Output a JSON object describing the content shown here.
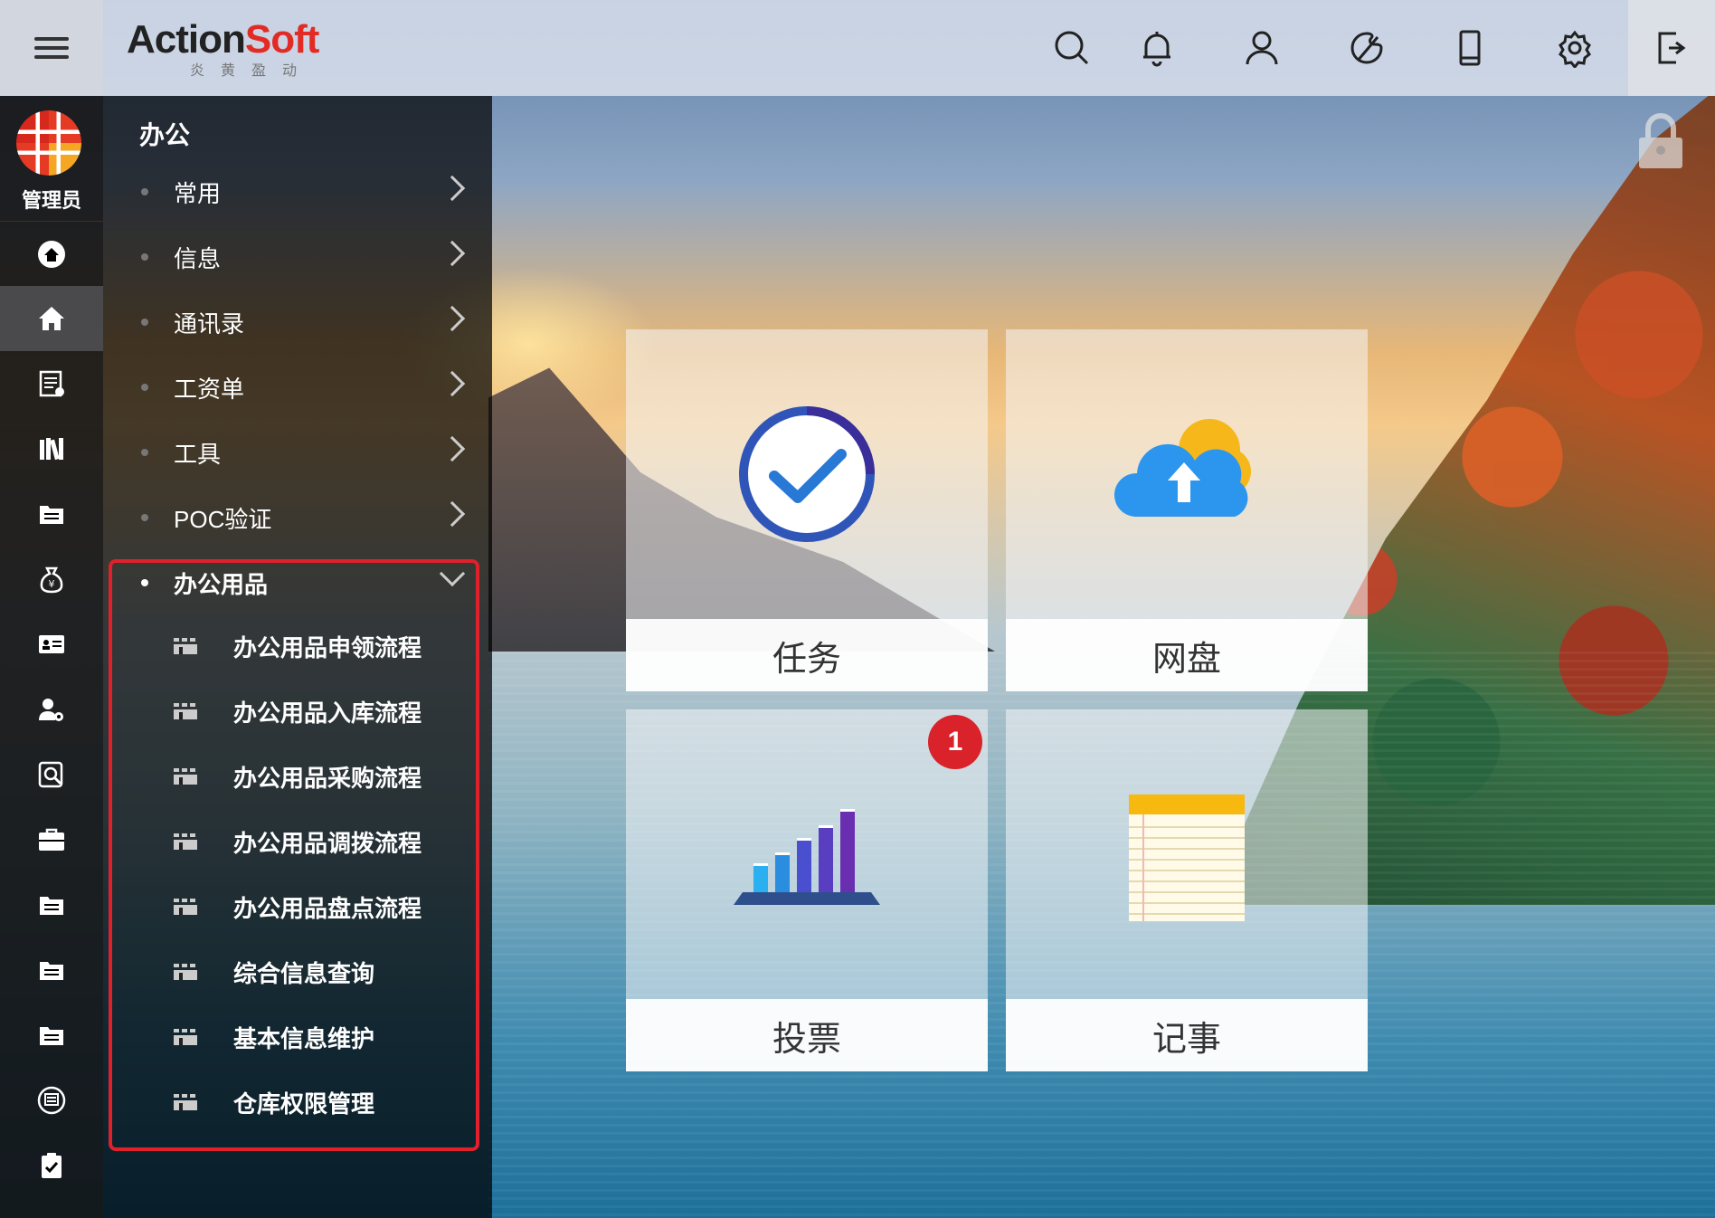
{
  "app": {
    "logo_main": "Action",
    "logo_accent": "Soft",
    "logo_sub": "炎黄盈动"
  },
  "topbar": {
    "icons": [
      "search-icon",
      "bell-icon",
      "user-icon",
      "theme-icon",
      "mobile-icon",
      "settings-icon",
      "logout-icon"
    ]
  },
  "user": {
    "name": "管理员"
  },
  "rail": {
    "icons": [
      "home-circle-icon",
      "home-icon",
      "list-doc-icon",
      "books-icon",
      "folder-icon",
      "moneybag-icon",
      "id-card-icon",
      "user-gear-icon",
      "search-doc-icon",
      "briefcase-icon",
      "folder-icon",
      "folder-icon",
      "folder-icon",
      "inbox-icon",
      "clipboard-check-icon"
    ]
  },
  "menu": {
    "title": "办公",
    "items": [
      {
        "label": "常用"
      },
      {
        "label": "信息"
      },
      {
        "label": "通讯录"
      },
      {
        "label": "工资单"
      },
      {
        "label": "工具"
      },
      {
        "label": "POC验证"
      }
    ],
    "expanded": {
      "label": "办公用品",
      "children": [
        {
          "label": "办公用品申领流程"
        },
        {
          "label": "办公用品入库流程"
        },
        {
          "label": "办公用品采购流程"
        },
        {
          "label": "办公用品调拨流程"
        },
        {
          "label": "办公用品盘点流程"
        },
        {
          "label": "综合信息查询"
        },
        {
          "label": "基本信息维护"
        },
        {
          "label": "仓库权限管理"
        }
      ]
    }
  },
  "tiles": [
    {
      "label": "任务",
      "icon": "task-check-icon"
    },
    {
      "label": "网盘",
      "icon": "cloud-upload-icon"
    },
    {
      "label": "投票",
      "icon": "vote-chart-icon",
      "badge": "1"
    },
    {
      "label": "记事",
      "icon": "notepad-icon"
    }
  ],
  "colors": {
    "accent_red": "#e32b25",
    "highlight_box": "#e0202b",
    "badge": "#d9222a"
  }
}
